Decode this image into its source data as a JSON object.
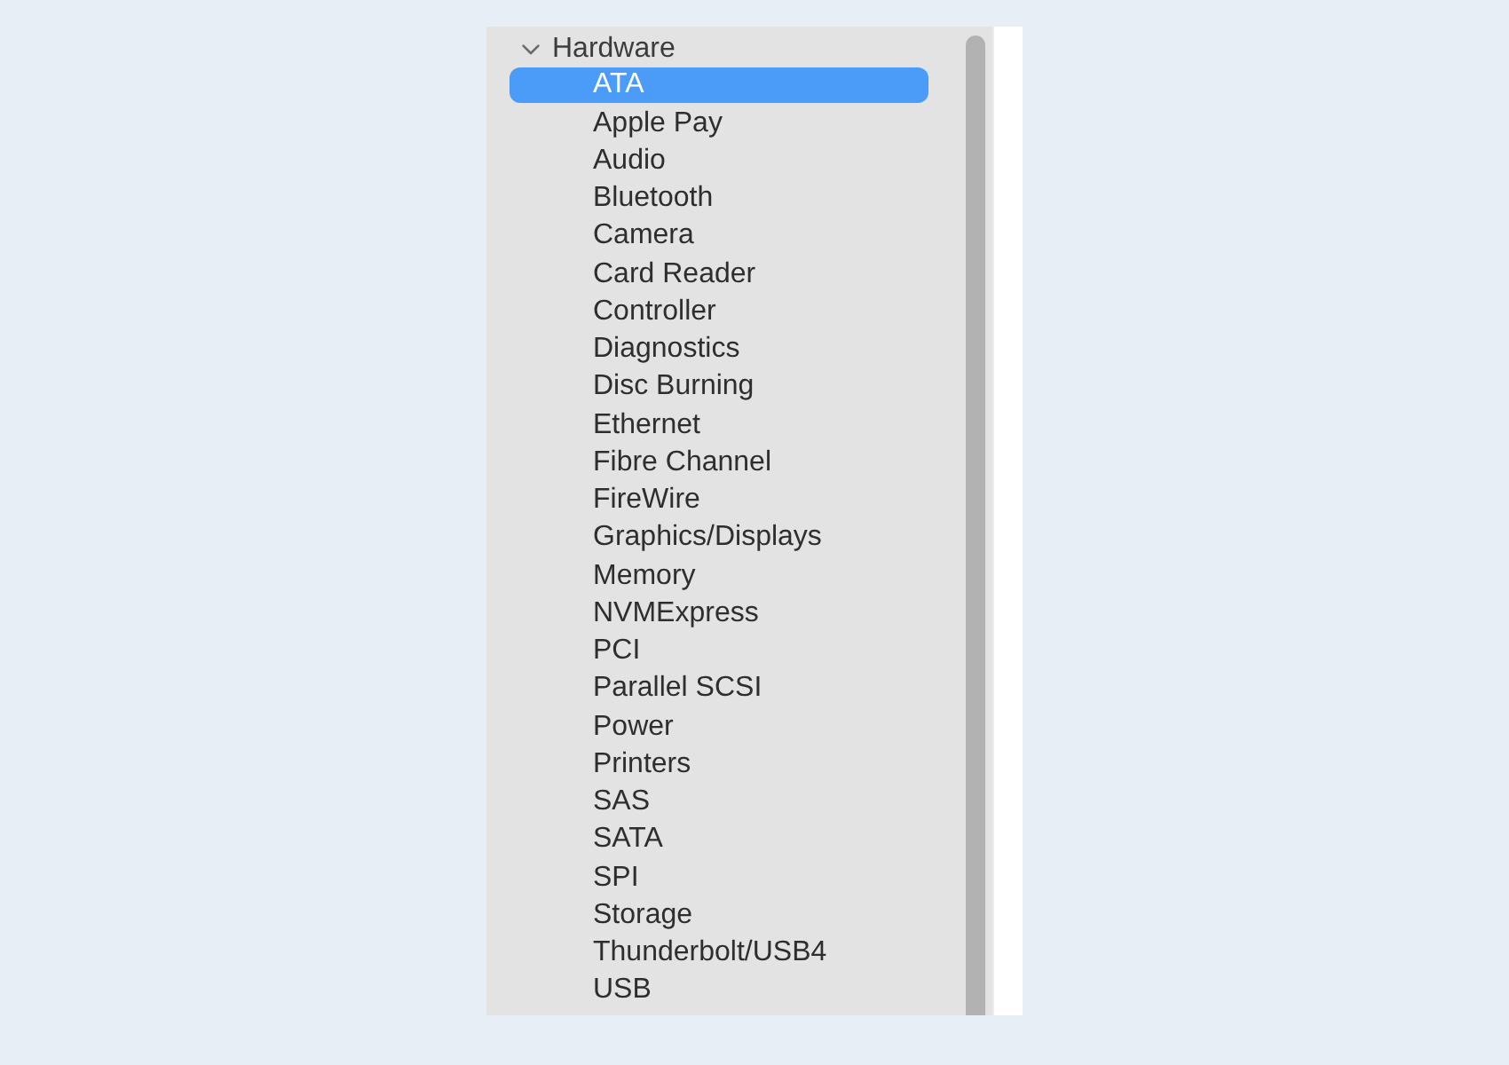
{
  "sidebar": {
    "section": {
      "label": "Hardware",
      "expanded": true,
      "children": [
        {
          "label": "ATA",
          "selected": true
        },
        {
          "label": "Apple Pay",
          "selected": false
        },
        {
          "label": "Audio",
          "selected": false
        },
        {
          "label": "Bluetooth",
          "selected": false
        },
        {
          "label": "Camera",
          "selected": false
        },
        {
          "label": "Card Reader",
          "selected": false
        },
        {
          "label": "Controller",
          "selected": false
        },
        {
          "label": "Diagnostics",
          "selected": false
        },
        {
          "label": "Disc Burning",
          "selected": false
        },
        {
          "label": "Ethernet",
          "selected": false
        },
        {
          "label": "Fibre Channel",
          "selected": false
        },
        {
          "label": "FireWire",
          "selected": false
        },
        {
          "label": "Graphics/Displays",
          "selected": false
        },
        {
          "label": "Memory",
          "selected": false
        },
        {
          "label": "NVMExpress",
          "selected": false
        },
        {
          "label": "PCI",
          "selected": false
        },
        {
          "label": "Parallel SCSI",
          "selected": false
        },
        {
          "label": "Power",
          "selected": false
        },
        {
          "label": "Printers",
          "selected": false
        },
        {
          "label": "SAS",
          "selected": false
        },
        {
          "label": "SATA",
          "selected": false
        },
        {
          "label": "SPI",
          "selected": false
        },
        {
          "label": "Storage",
          "selected": false
        },
        {
          "label": "Thunderbolt/USB4",
          "selected": false
        },
        {
          "label": "USB",
          "selected": false
        }
      ]
    }
  }
}
